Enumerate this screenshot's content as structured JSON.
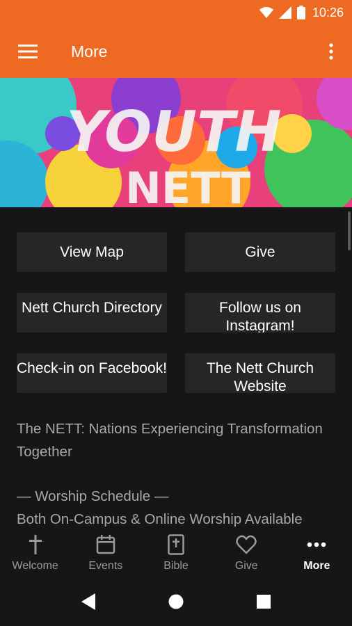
{
  "status_bar": {
    "time": "10:26",
    "icons": [
      "wifi-icon",
      "signal-icon",
      "battery-icon"
    ]
  },
  "app_bar": {
    "title": "More",
    "menu_icon": "hamburger-menu-icon",
    "overflow_icon": "more-vert-icon"
  },
  "banner": {
    "text_line1": "YOUTH",
    "text_line2": "NETT"
  },
  "buttons": [
    {
      "label": "View Map"
    },
    {
      "label": "Give"
    },
    {
      "label": "Nett Church Directory"
    },
    {
      "label": "Follow us on Instagram!"
    },
    {
      "label": "Check-in on Facebook!"
    },
    {
      "label": "The Nett Church Website"
    }
  ],
  "about": {
    "line1": "The NETT: Nations Experiencing Transformation Together",
    "line2": "— Worship Schedule —",
    "line3": "Both On-Campus & Online Worship Available"
  },
  "bottom_nav": [
    {
      "label": "Welcome",
      "icon": "cross-icon",
      "active": false
    },
    {
      "label": "Events",
      "icon": "calendar-icon",
      "active": false
    },
    {
      "label": "Bible",
      "icon": "bible-icon",
      "active": false
    },
    {
      "label": "Give",
      "icon": "heart-icon",
      "active": false
    },
    {
      "label": "More",
      "icon": "more-horiz-icon",
      "active": true
    }
  ],
  "colors": {
    "primary": "#ee6a22",
    "background": "#161618",
    "button": "#262628",
    "muted_text": "#a8a8a8"
  }
}
